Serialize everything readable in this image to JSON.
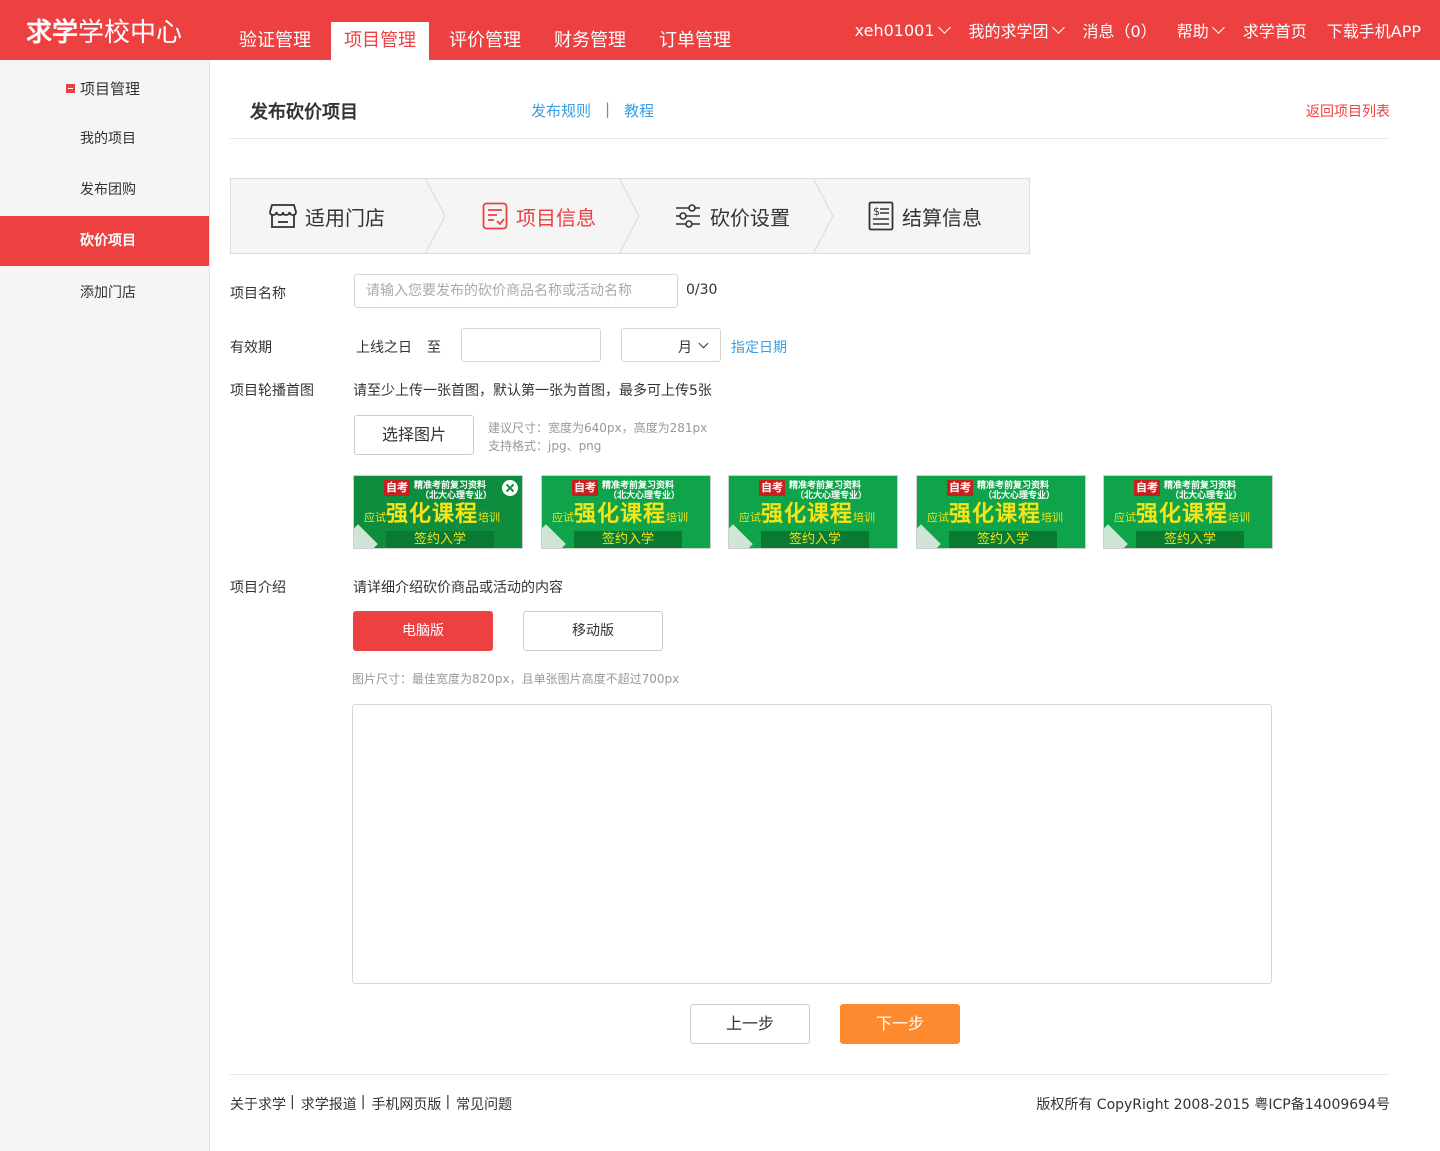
{
  "header": {
    "logo_bold": "求学",
    "logo_rest": "学校中心",
    "nav": [
      "验证管理",
      "项目管理",
      "评价管理",
      "财务管理",
      "订单管理"
    ],
    "active_nav": "项目管理",
    "user": "xeh01001",
    "my_group": "我的求学团",
    "messages": "消息（0）",
    "help": "帮助",
    "home": "求学首页",
    "download": "下载手机APP"
  },
  "sidebar": {
    "heading": "项目管理",
    "items": [
      "我的项目",
      "发布团购",
      "砍价项目",
      "添加门店"
    ],
    "active": "砍价项目"
  },
  "page": {
    "title": "发布砍价项目",
    "rules_link": "发布规则",
    "separator": "|",
    "tutorial_link": "教程",
    "back_link": "返回项目列表"
  },
  "steps": [
    {
      "label": "适用门店",
      "icon": "store-icon"
    },
    {
      "label": "项目信息",
      "icon": "info-icon"
    },
    {
      "label": "砍价设置",
      "icon": "sliders-icon"
    },
    {
      "label": "结算信息",
      "icon": "bill-icon"
    }
  ],
  "active_step": "项目信息",
  "form": {
    "name_label": "项目名称",
    "name_placeholder": "请输入您要发布的砍价商品名称或活动名称",
    "name_value": "",
    "name_counter": "0/30",
    "validity_label": "有效期",
    "validity_from": "上线之日",
    "validity_to": "至",
    "validity_value": "",
    "unit_value": "月",
    "specify_date": "指定日期",
    "carousel_label": "项目轮播首图",
    "carousel_desc": "请至少上传一张首图，默认第一张为首图，最多可上传5张",
    "choose_image": "选择图片",
    "size_hint": "建议尺寸：宽度为640px，高度为281px",
    "format_hint": "支持格式：jpg、png",
    "intro_label": "项目介绍",
    "intro_desc": "请详细介绍砍价商品或活动的内容",
    "pc_version": "电脑版",
    "mobile_version": "移动版",
    "image_size_hint": "图片尺寸：最佳宽度为820px，且单张图片高度不超过700px",
    "prev": "上一步",
    "next": "下一步"
  },
  "thumbnails": [
    {
      "tag": "自考",
      "line1": "精准考前复习资料",
      "line2": "（北大心理专业）",
      "prefix": "应试",
      "big": "强化课程",
      "suffix": "培训",
      "bar": "签约入学"
    },
    {
      "tag": "自考",
      "line1": "精准考前复习资料",
      "line2": "（北大心理专业）",
      "prefix": "应试",
      "big": "强化课程",
      "suffix": "培训",
      "bar": "签约入学"
    },
    {
      "tag": "自考",
      "line1": "精准考前复习资料",
      "line2": "（北大心理专业）",
      "prefix": "应试",
      "big": "强化课程",
      "suffix": "培训",
      "bar": "签约入学"
    },
    {
      "tag": "自考",
      "line1": "精准考前复习资料",
      "line2": "（北大心理专业）",
      "prefix": "应试",
      "big": "强化课程",
      "suffix": "培训",
      "bar": "签约入学"
    },
    {
      "tag": "自考",
      "line1": "精准考前复习资料",
      "line2": "（北大心理专业）",
      "prefix": "应试",
      "big": "强化课程",
      "suffix": "培训",
      "bar": "签约入学"
    }
  ],
  "footer": {
    "links": [
      "关于求学",
      "求学报道",
      "手机网页版",
      "常见问题"
    ],
    "link_sep": "|",
    "copyright": "版权所有 CopyRight 2008-2015 粤ICP备14009694号"
  },
  "colors": {
    "brand_red": "#ed4040",
    "link_blue": "#3a9ee0",
    "next_orange": "#fd8a2e",
    "thumb_green": "#0fa34a"
  }
}
